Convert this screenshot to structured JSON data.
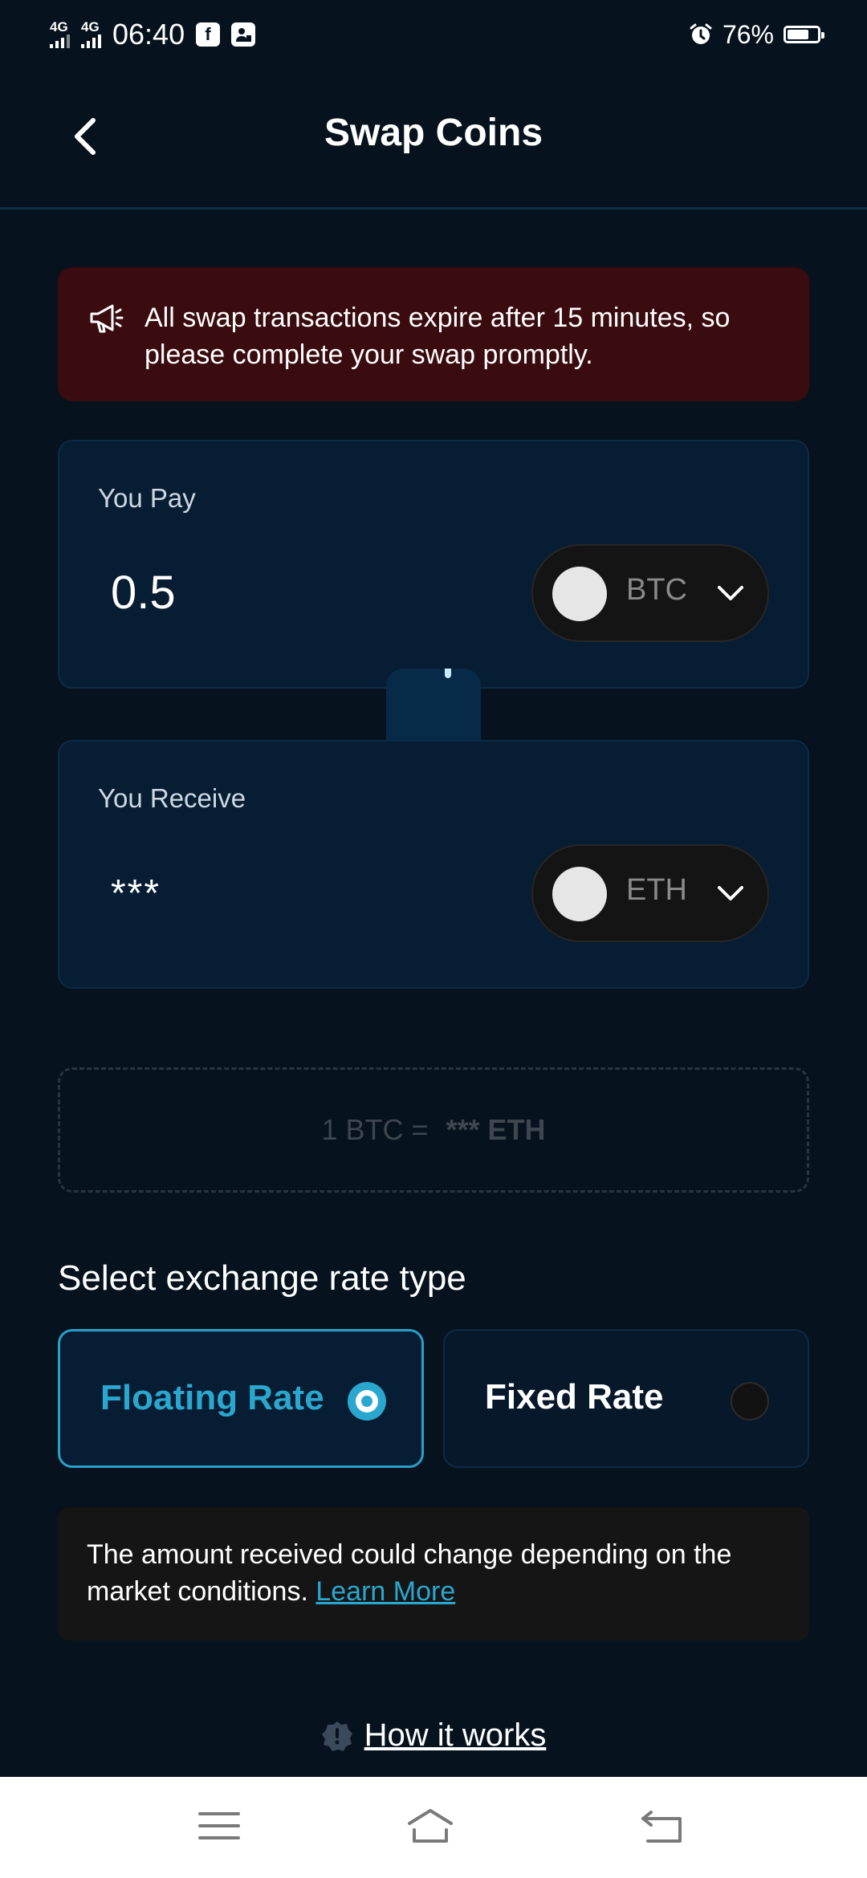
{
  "status_bar": {
    "network1": "4G",
    "network2": "4G",
    "time": "06:40",
    "battery_percent": "76%",
    "battery_level": 0.76
  },
  "header": {
    "title": "Swap Coins"
  },
  "warning": {
    "text": "All swap transactions expire after 15 minutes, so please complete your swap promptly."
  },
  "pay": {
    "label": "You Pay",
    "amount": "0.5",
    "currency": "BTC"
  },
  "receive": {
    "label": "You Receive",
    "amount": "***",
    "currency": "ETH"
  },
  "rate": {
    "left": "1 BTC =",
    "right": "*** ETH"
  },
  "rate_type": {
    "title": "Select exchange rate type",
    "options": [
      {
        "label": "Floating Rate",
        "selected": true
      },
      {
        "label": "Fixed Rate",
        "selected": false
      }
    ]
  },
  "info": {
    "text": "The amount received could change depending on the market conditions.",
    "link": "Learn More"
  },
  "how_it_works": "How it works",
  "colors": {
    "background": "#06121d",
    "card": "#071d33",
    "accent": "#2aa7cf",
    "warning_bg": "#3a0b0f"
  },
  "icons": [
    "back-arrow-icon",
    "megaphone-icon",
    "chevron-down-icon",
    "swap-icon",
    "info-badge-icon",
    "menu-icon",
    "home-icon",
    "back-nav-icon"
  ]
}
